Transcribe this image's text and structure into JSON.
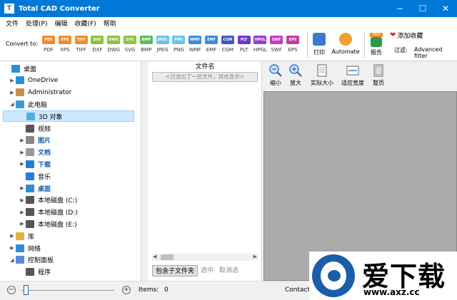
{
  "window": {
    "title": "Total CAD Converter",
    "app_icon": "T",
    "buttons": {
      "minimize": "─",
      "maximize": "☐",
      "close": "✕"
    }
  },
  "menu": [
    "文件",
    "处理(P)",
    "编辑",
    "收藏(F)",
    "帮助"
  ],
  "toolbar": {
    "convert_to": "Convert to:",
    "formats": [
      {
        "label": "PDF",
        "color": "#f08c2c"
      },
      {
        "label": "XPS",
        "color": "#f08c2c"
      },
      {
        "label": "TIFF",
        "color": "#f08c2c"
      },
      {
        "label": "DXF",
        "color": "#8cc43c"
      },
      {
        "label": "DWG",
        "color": "#8cc43c"
      },
      {
        "label": "SVG",
        "color": "#8cc43c"
      },
      {
        "label": "BMP",
        "color": "#5cbc5c"
      },
      {
        "label": "JPEG",
        "color": "#6cc4e4"
      },
      {
        "label": "PNG",
        "color": "#6cc4e4"
      },
      {
        "label": "WMF",
        "color": "#3c8cdc"
      },
      {
        "label": "EMF",
        "color": "#3c8cdc"
      },
      {
        "label": "CGM",
        "color": "#3c5cc4"
      },
      {
        "label": "PLT",
        "color": "#6c3cc4"
      },
      {
        "label": "HPGL",
        "color": "#9c3cc4"
      },
      {
        "label": "SWF",
        "color": "#c43cc4"
      },
      {
        "label": "EPS",
        "color": "#c43c9c"
      }
    ],
    "print_label": "打印",
    "automate_label": "Automate",
    "report_label": "报告",
    "report_badge": "PRO",
    "favorite_label": "添加收藏",
    "filter_label": "过滤:",
    "advanced_filter_label": "Advanced filter"
  },
  "tree": [
    {
      "label": "桌面",
      "level": 0,
      "arrow": "",
      "icon": "desktop",
      "color": "#2a8fd8"
    },
    {
      "label": "OneDrive",
      "level": 1,
      "arrow": "▶",
      "icon": "cloud",
      "color": "#2a8fd8"
    },
    {
      "label": "Administrator",
      "level": 1,
      "arrow": "▶",
      "icon": "user",
      "color": "#c89050"
    },
    {
      "label": "此电脑",
      "level": 1,
      "arrow": "◢",
      "icon": "pc",
      "color": "#3a9ad8"
    },
    {
      "label": "3D 对象",
      "level": 2,
      "arrow": "",
      "icon": "cube",
      "color": "#4ab0e0",
      "selected": true
    },
    {
      "label": "视频",
      "level": 2,
      "arrow": "",
      "icon": "video",
      "color": "#555555"
    },
    {
      "label": "图片",
      "level": 2,
      "arrow": "▶",
      "icon": "image",
      "color": "#888888",
      "blue": true
    },
    {
      "label": "文档",
      "level": 2,
      "arrow": "▶",
      "icon": "doc",
      "color": "#999999",
      "blue": true
    },
    {
      "label": "下载",
      "level": 2,
      "arrow": "▶",
      "icon": "download",
      "color": "#2a7ad8",
      "blue": true
    },
    {
      "label": "音乐",
      "level": 2,
      "arrow": "",
      "icon": "music",
      "color": "#2a7ad8"
    },
    {
      "label": "桌面",
      "level": 2,
      "arrow": "▶",
      "icon": "desktop",
      "color": "#2a8fd8",
      "blue": true
    },
    {
      "label": "本地磁盘 (C:)",
      "level": 2,
      "arrow": "▶",
      "icon": "disk",
      "color": "#555555"
    },
    {
      "label": "本地磁盘 (D:)",
      "level": 2,
      "arrow": "▶",
      "icon": "disk",
      "color": "#555555"
    },
    {
      "label": "本地磁盘 (E:)",
      "level": 2,
      "arrow": "▶",
      "icon": "disk",
      "color": "#555555"
    },
    {
      "label": "库",
      "level": 1,
      "arrow": "▶",
      "icon": "library",
      "color": "#e0b040"
    },
    {
      "label": "网络",
      "level": 1,
      "arrow": "▶",
      "icon": "network",
      "color": "#2a8fd8"
    },
    {
      "label": "控制面板",
      "level": 1,
      "arrow": "◢",
      "icon": "control",
      "color": "#5a8ad8"
    },
    {
      "label": "程序",
      "level": 2,
      "arrow": "",
      "icon": "program",
      "color": "#555555"
    }
  ],
  "files": {
    "header": "文件名",
    "filter_placeholder": "<过滤出了一些文件，双击显示>",
    "include_subfolders": "包含子文件夹",
    "select": "选中",
    "deselect": "取消选"
  },
  "preview": {
    "tools": [
      {
        "label": "缩小",
        "icon": "zoom-out"
      },
      {
        "label": "放大",
        "icon": "zoom-in"
      },
      {
        "label": "实际大小",
        "icon": "actual-size"
      },
      {
        "label": "适应宽度",
        "icon": "fit-width"
      },
      {
        "label": "整页",
        "icon": "full-page"
      }
    ]
  },
  "status": {
    "items_label": "Items:",
    "items_value": "0",
    "contact": "Contact",
    "zoom_minus": "−",
    "zoom_plus": "+",
    "zoom_level": 0.02
  },
  "watermark": {
    "title": "爱下载",
    "url": "www.axz.cc"
  }
}
